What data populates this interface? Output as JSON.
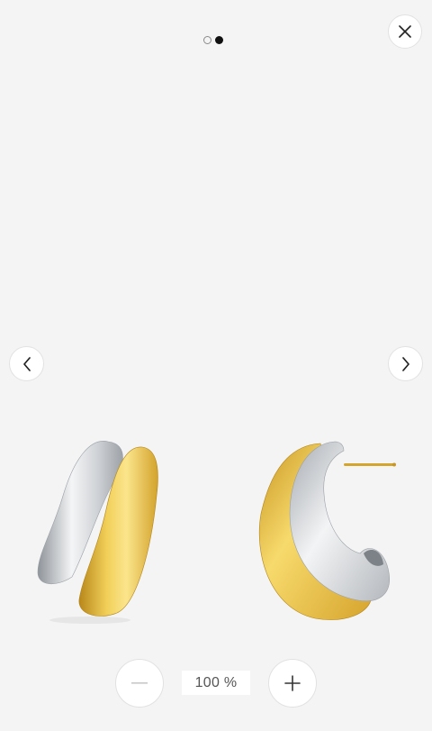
{
  "carousel": {
    "slide_count": 2,
    "active_index": 1
  },
  "buttons": {
    "close_icon": "close-icon",
    "prev_icon": "chevron-left-icon",
    "next_icon": "chevron-right-icon",
    "zoom_out_icon": "minus-icon",
    "zoom_in_icon": "plus-icon"
  },
  "zoom": {
    "level_label": "100 %"
  },
  "image": {
    "subject": "product-photo-earrings",
    "colors": {
      "gold": "#e0b431",
      "silver": "#cfd2d6",
      "background": "#f4f4f4"
    }
  }
}
